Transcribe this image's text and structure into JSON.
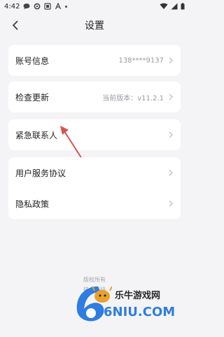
{
  "status": {
    "time": "4:42"
  },
  "topbar": {
    "title": "设置"
  },
  "cards": {
    "account": {
      "label": "账号信息",
      "value": "138****9137"
    },
    "update": {
      "label": "检查更新",
      "value": "当前版本：v11.2.1"
    },
    "emergency": {
      "label": "紧急联系人"
    },
    "legal": [
      {
        "label": "用户服务协议"
      },
      {
        "label": "隐私政策"
      }
    ]
  },
  "footer": {
    "line1": "版权所有",
    "line2": "技术支持"
  },
  "watermark": {
    "brand": "乐牛游戏网",
    "domain": "6NIU.COM"
  },
  "colors": {
    "background": "#f4f4f6",
    "arrow": "#d9534f",
    "watermark_blue": "#2f7de0"
  }
}
